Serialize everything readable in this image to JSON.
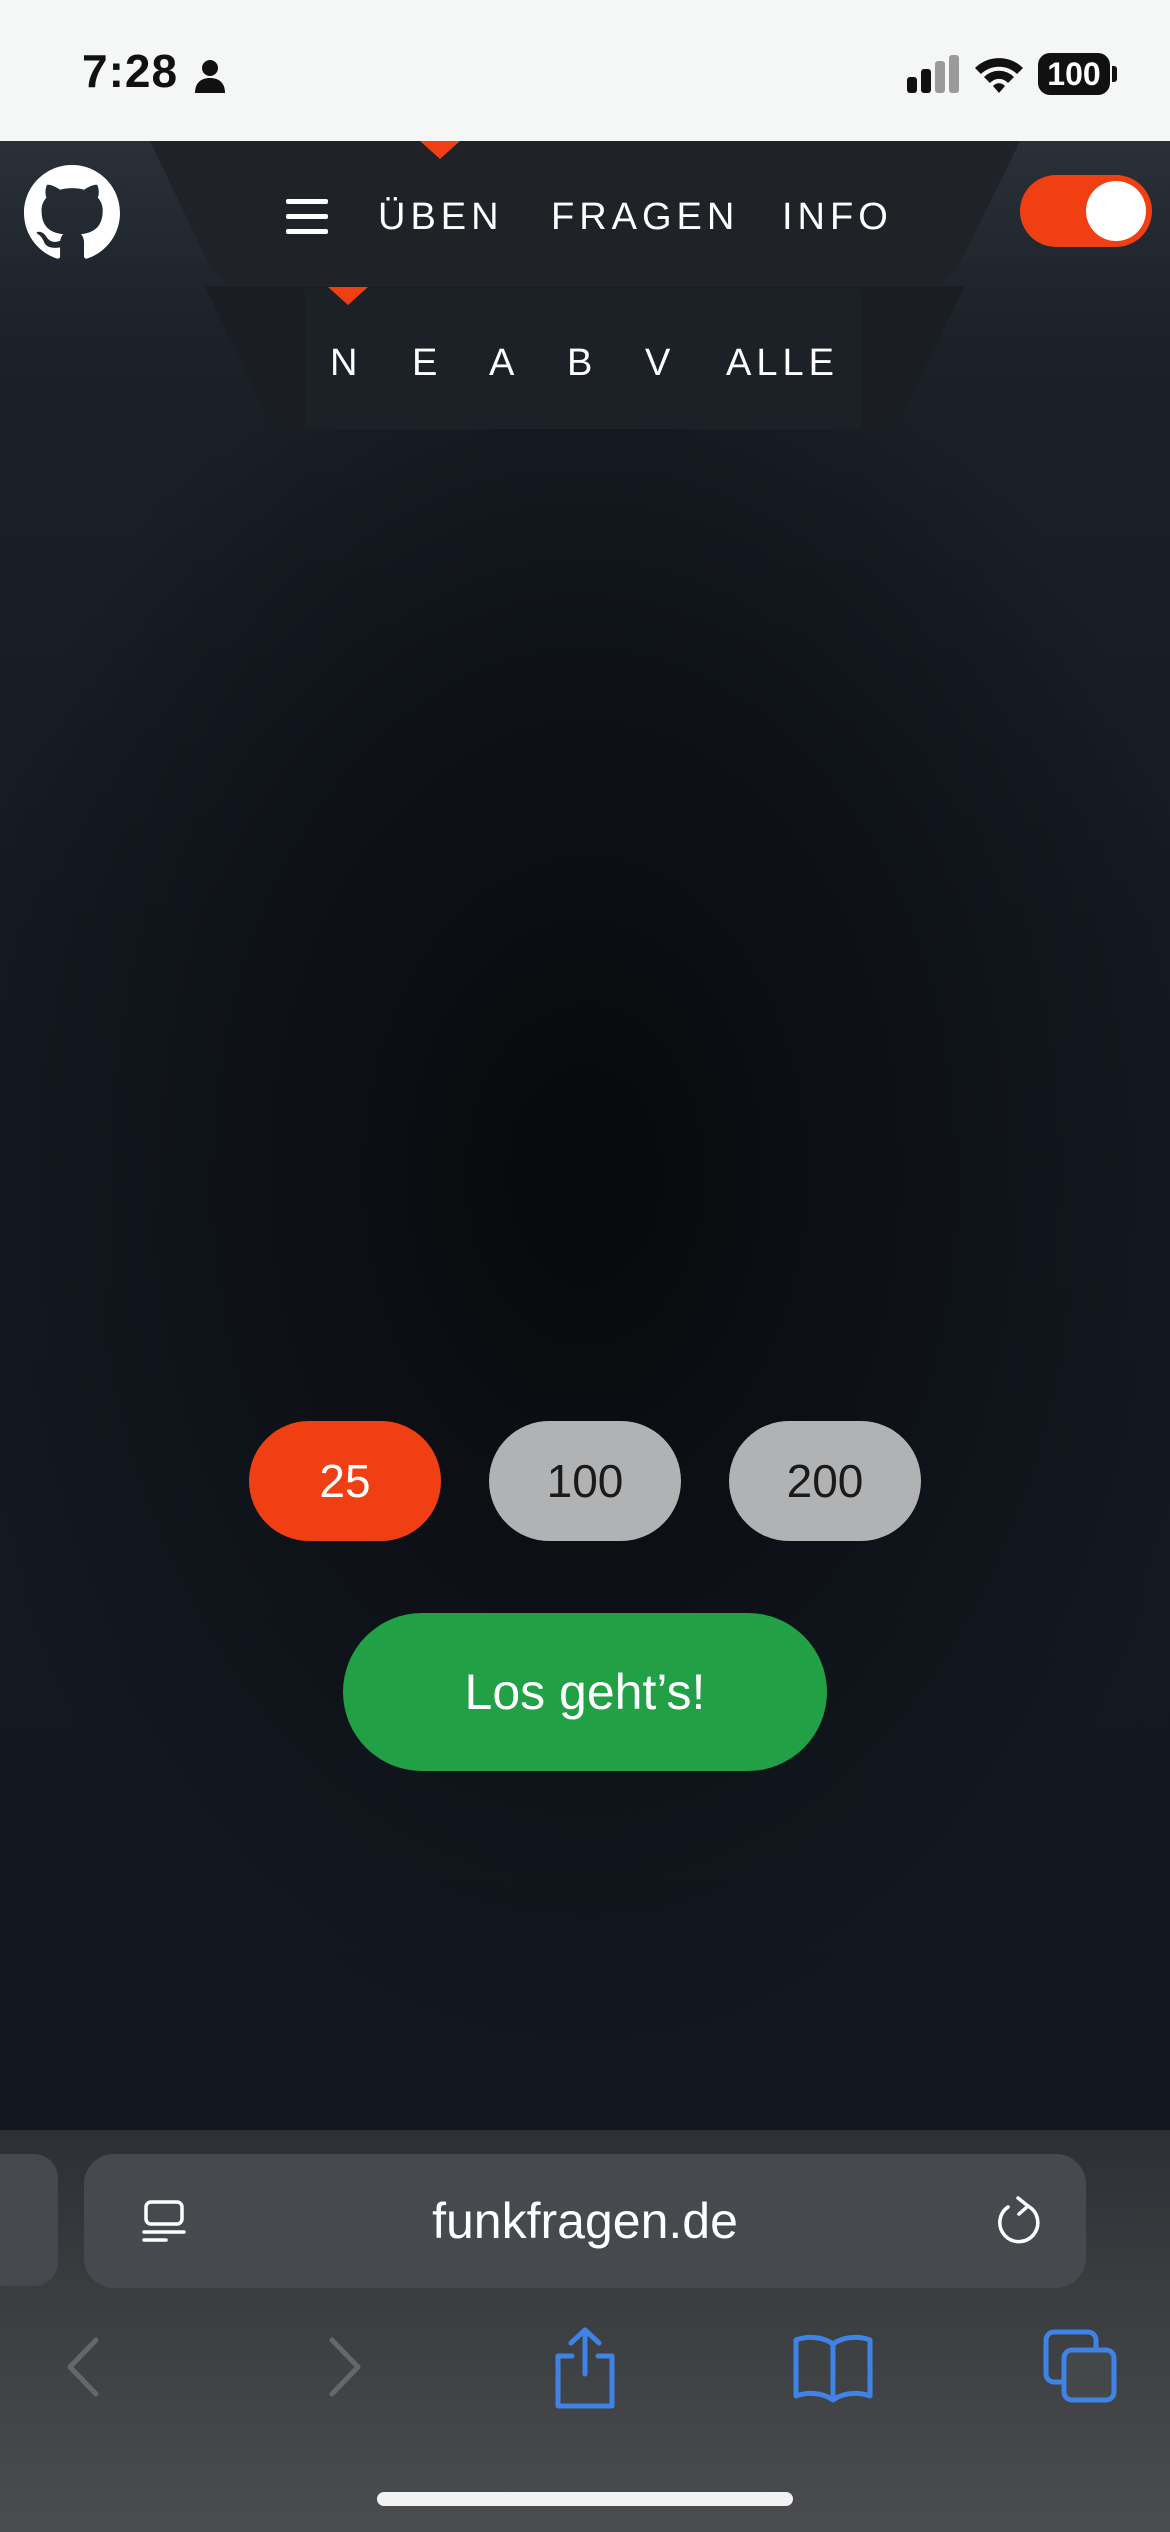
{
  "status_bar": {
    "time": "7:28",
    "battery": "100"
  },
  "nav": {
    "items": [
      {
        "label": "ÜBEN",
        "active": true
      },
      {
        "label": "FRAGEN",
        "active": false
      },
      {
        "label": "INFO",
        "active": false
      }
    ],
    "dark_mode_toggle": "on"
  },
  "submenu": {
    "items": [
      {
        "label": "N",
        "active": true
      },
      {
        "label": "E",
        "active": false
      },
      {
        "label": "A",
        "active": false
      },
      {
        "label": "B",
        "active": false
      },
      {
        "label": "V",
        "active": false
      },
      {
        "label": "ALLE",
        "active": false
      }
    ]
  },
  "question_count": {
    "options": [
      {
        "label": "25",
        "selected": true
      },
      {
        "label": "100",
        "selected": false
      },
      {
        "label": "200",
        "selected": false
      }
    ]
  },
  "start_button": "Los geht’s!",
  "browser": {
    "url": "funkfragen.de"
  },
  "colors": {
    "accent": "#f04013",
    "start_green": "#21a046",
    "inactive_pill": "#b1b2b3",
    "browser_blue": "#3f83e6"
  },
  "icons": [
    "person-icon",
    "cellular-signal-icon",
    "wifi-icon",
    "battery-icon",
    "github-icon",
    "hamburger-menu-icon",
    "reader-mode-icon",
    "reload-icon",
    "back-arrow-icon",
    "forward-arrow-icon",
    "share-icon",
    "bookmarks-icon",
    "tabs-icon"
  ]
}
